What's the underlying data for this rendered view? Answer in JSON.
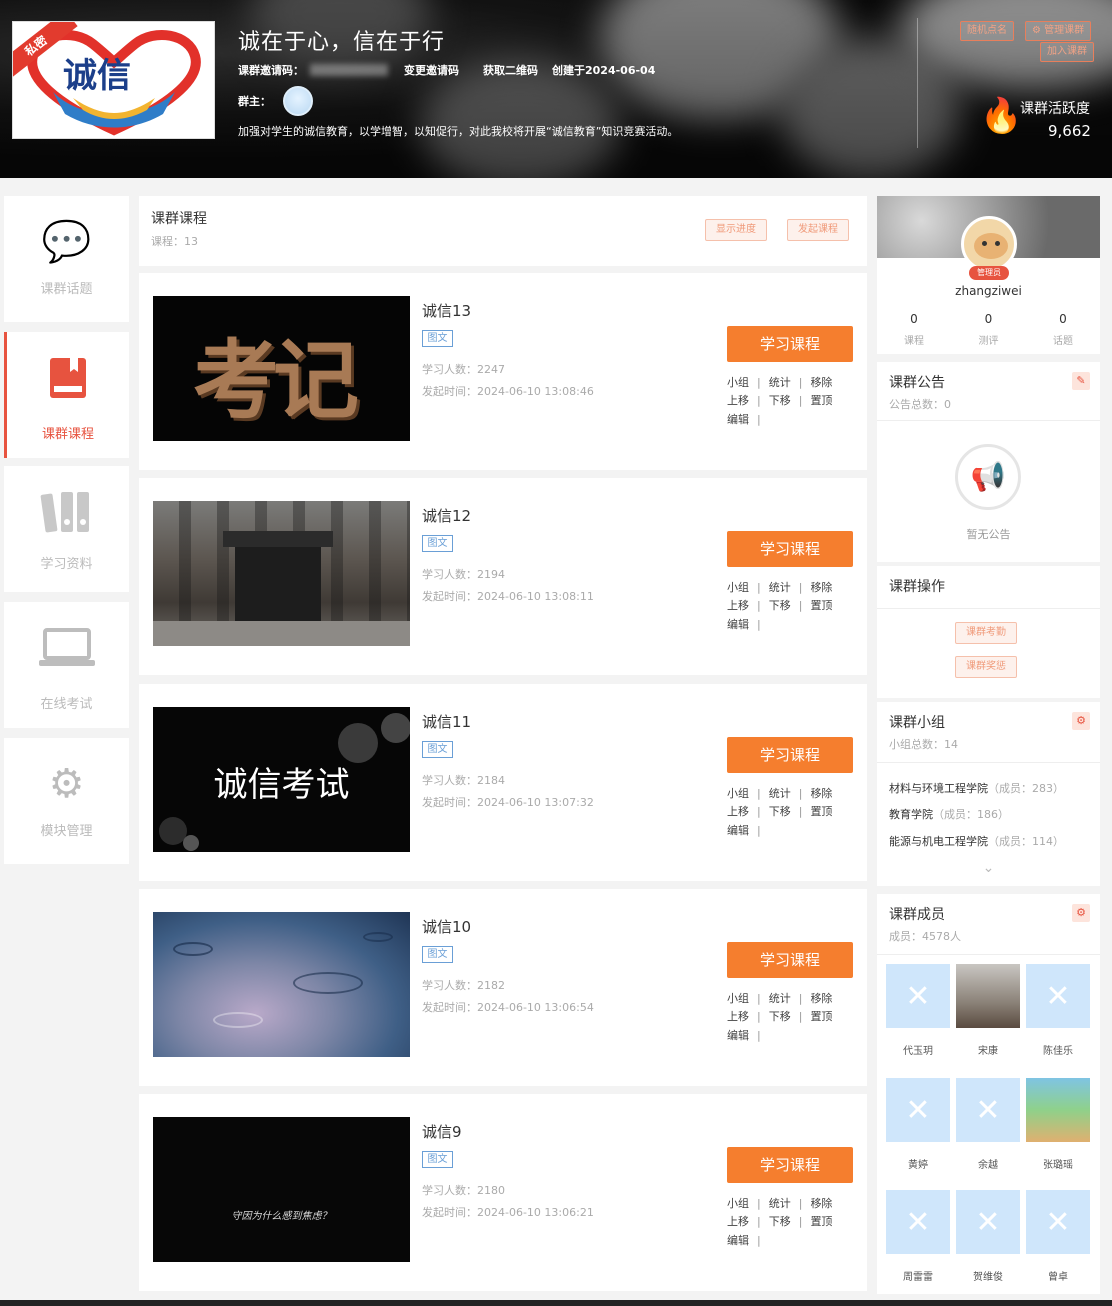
{
  "header": {
    "private_tag": "私密",
    "logo_text": "诚信",
    "title": "诚在于心，信在于行",
    "invite_label": "课群邀请码：",
    "change_invite": "变更邀请码",
    "get_qr": "获取二维码",
    "created": "创建于2024-06-04",
    "owner_label": "群主：",
    "description": "加强对学生的诚信教育，以学增智，以知促行，对此我校将开展“诚信教育”知识竞赛活动。",
    "btn_random": "随机点名",
    "btn_manage": "管理课群",
    "btn_join": "加入课群",
    "activity_label": "课群活跃度",
    "activity_value": "9,662"
  },
  "nav": [
    {
      "label": "课群话题",
      "icon": "chat-icon"
    },
    {
      "label": "课群课程",
      "icon": "book-icon"
    },
    {
      "label": "学习资料",
      "icon": "binder-icon"
    },
    {
      "label": "在线考试",
      "icon": "laptop-icon"
    },
    {
      "label": "模块管理",
      "icon": "gear-icon"
    }
  ],
  "courses_header": {
    "title": "课群课程",
    "count_label": "课程：13",
    "btn_show_progress": "显示进度",
    "btn_publish": "发起课程"
  },
  "course_labels": {
    "tag": "图文",
    "learners_prefix": "学习人数：",
    "time_prefix": "发起时间：",
    "study_btn": "学习课程",
    "act_group": "小组",
    "act_stats": "统计",
    "act_remove": "移除",
    "act_up": "上移",
    "act_down": "下移",
    "act_top": "置顶",
    "act_edit": "编辑",
    "sep": "|"
  },
  "courses": [
    {
      "title": "诚信13",
      "learners": "2247",
      "time": "2024-06-10 13:08:46",
      "thumb_text": "考记"
    },
    {
      "title": "诚信12",
      "learners": "2194",
      "time": "2024-06-10 13:08:11",
      "thumb_text": ""
    },
    {
      "title": "诚信11",
      "learners": "2184",
      "time": "2024-06-10 13:07:32",
      "thumb_text": "诚信考试"
    },
    {
      "title": "诚信10",
      "learners": "2182",
      "time": "2024-06-10 13:06:54",
      "thumb_text": ""
    },
    {
      "title": "诚信9",
      "learners": "2180",
      "time": "2024-06-10 13:06:21",
      "thumb_text": "守因为什么感到焦虑？"
    }
  ],
  "profile": {
    "role_badge": "管理员",
    "username": "zhangziwei",
    "stats": [
      {
        "value": "0",
        "label": "课程"
      },
      {
        "value": "0",
        "label": "测评"
      },
      {
        "value": "0",
        "label": "话题"
      }
    ]
  },
  "announcement": {
    "title": "课群公告",
    "count": "公告总数：0",
    "empty": "暂无公告"
  },
  "operations": {
    "title": "课群操作",
    "btn_attendance": "课群考勤",
    "btn_award": "课群奖惩"
  },
  "groups": {
    "title": "课群小组",
    "count": "小组总数：14",
    "items": [
      {
        "name": "材料与环境工程学院",
        "members": "（成员：283）"
      },
      {
        "name": "教育学院",
        "members": "（成员：186）"
      },
      {
        "name": "能源与机电工程学院",
        "members": "（成员：114）"
      }
    ]
  },
  "members": {
    "title": "课群成员",
    "count": "成员：4578人",
    "items": [
      "代玉玥",
      "宋康",
      "陈佳乐",
      "黄婷",
      "余越",
      "张璐瑶",
      "周雷雷",
      "贺维俊",
      "曾卓"
    ]
  }
}
